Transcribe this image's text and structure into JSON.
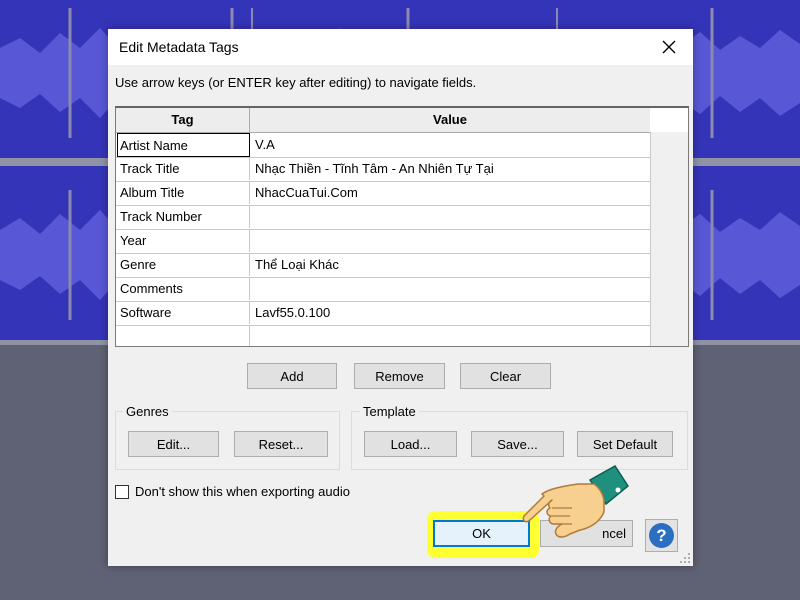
{
  "dialog": {
    "title": "Edit Metadata Tags",
    "instruction": "Use arrow keys (or ENTER key after editing) to navigate fields."
  },
  "grid": {
    "headers": {
      "tag": "Tag",
      "value": "Value"
    },
    "rows": [
      {
        "tag": "Artist Name",
        "value": "V.A"
      },
      {
        "tag": "Track Title",
        "value": "Nhạc Thiền - Tĩnh Tâm - An Nhiên Tự Tại"
      },
      {
        "tag": "Album Title",
        "value": "NhacCuaTui.Com"
      },
      {
        "tag": "Track Number",
        "value": ""
      },
      {
        "tag": "Year",
        "value": ""
      },
      {
        "tag": "Genre",
        "value": "Thể Loại Khác"
      },
      {
        "tag": "Comments",
        "value": ""
      },
      {
        "tag": "Software",
        "value": "Lavf55.0.100"
      },
      {
        "tag": "",
        "value": ""
      }
    ]
  },
  "row_buttons": {
    "add": "Add",
    "remove": "Remove",
    "clear": "Clear"
  },
  "genres": {
    "title": "Genres",
    "edit": "Edit...",
    "reset": "Reset..."
  },
  "template": {
    "title": "Template",
    "load": "Load...",
    "save": "Save...",
    "set_default": "Set Default"
  },
  "checkbox_label": "Don't show this when exporting audio",
  "footer": {
    "ok": "OK",
    "cancel_visible": "ncel",
    "help": "?"
  },
  "icons": {
    "close": "close-icon",
    "help": "help-icon",
    "pointer": "pointing-hand-icon"
  },
  "colors": {
    "highlight": "#ffff32",
    "waveform": "#3434b8",
    "focus_border": "#0078d7"
  }
}
